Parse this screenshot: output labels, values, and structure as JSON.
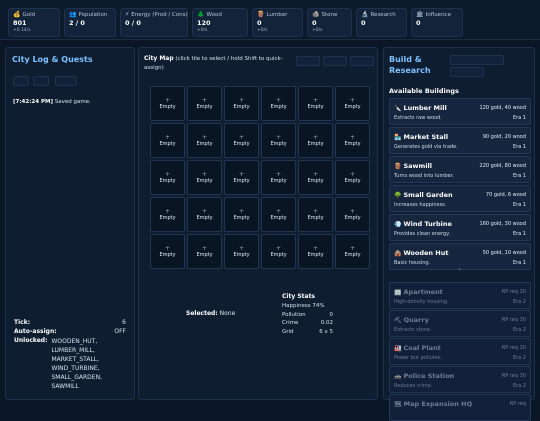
{
  "resources": [
    {
      "icon": "💰",
      "icon_name": "gold-icon",
      "label": "Gold",
      "value": "801",
      "rate": "+0.14/s"
    },
    {
      "icon": "👥",
      "icon_name": "population-icon",
      "label": "Population",
      "value": "2 / 0",
      "rate": ""
    },
    {
      "icon": "⚡",
      "icon_name": "energy-icon",
      "label": "Energy (Prod / Cons)",
      "value": "0 / 0",
      "rate": ""
    },
    {
      "icon": "🌲",
      "icon_name": "wood-icon",
      "label": "Wood",
      "value": "120",
      "rate": "+0/s"
    },
    {
      "icon": "🪵",
      "icon_name": "lumber-icon",
      "label": "Lumber",
      "value": "0",
      "rate": "+0/s"
    },
    {
      "icon": "🪨",
      "icon_name": "stone-icon",
      "label": "Stone",
      "value": "0",
      "rate": "+0/s"
    },
    {
      "icon": "🔬",
      "icon_name": "research-icon",
      "label": "Research",
      "value": "0",
      "rate": ""
    },
    {
      "icon": "🏛",
      "icon_name": "influence-icon",
      "label": "Influence",
      "value": "0",
      "rate": ""
    }
  ],
  "left": {
    "title": "City Log & Quests",
    "log_time": "[7:42:24 PM]",
    "log_text": "Saved game.",
    "tick_label": "Tick:",
    "tick_value": "6",
    "autoassign_label": "Auto-assign:",
    "autoassign_value": "OFF",
    "unlocked_label": "Unlocked:",
    "unlocked_value": "WOODEN_HUT, LUMBER_MILL, MARKET_STALL, WIND_TURBINE, SMALL_GARDEN, SAWMILL"
  },
  "center": {
    "map_title": "City Map",
    "map_hint": "(click tile to select / hold Shift to quick-assign)",
    "tile_plus": "+",
    "tile_label": "Empty",
    "selected_label": "Selected:",
    "selected_value": "None",
    "stats_title": "City Stats",
    "stats_happiness": "Happiness 74%",
    "stats_pollution_label": "Pollution",
    "stats_pollution_value": "0",
    "stats_crime_label": "Crime",
    "stats_crime_value": "0.02",
    "stats_grid_label": "Grid",
    "stats_grid_value": "6 x 5"
  },
  "right": {
    "title": "Build & Research",
    "available_title": "Available Buildings",
    "separator": "•",
    "buildings": [
      {
        "icon": "🔪",
        "icon_name": "lumber-mill-icon",
        "name": "Lumber Mill",
        "desc": "Extracts raw wood.",
        "cost": "120 gold, 40 wood",
        "era": "Era 1",
        "locked": false
      },
      {
        "icon": "🏪",
        "icon_name": "market-stall-icon",
        "name": "Market Stall",
        "desc": "Generates gold via trade.",
        "cost": "90 gold, 20 wood",
        "era": "Era 1",
        "locked": false
      },
      {
        "icon": "🪵",
        "icon_name": "sawmill-icon",
        "name": "Sawmill",
        "desc": "Turns wood into lumber.",
        "cost": "220 gold, 80 wood",
        "era": "Era 1",
        "locked": false
      },
      {
        "icon": "🌳",
        "icon_name": "small-garden-icon",
        "name": "Small Garden",
        "desc": "Increases happiness.",
        "cost": "70 gold, 6 wood",
        "era": "Era 1",
        "locked": false
      },
      {
        "icon": "💨",
        "icon_name": "wind-turbine-icon",
        "name": "Wind Turbine",
        "desc": "Provides clean energy.",
        "cost": "160 gold, 30 wood",
        "era": "Era 1",
        "locked": false
      },
      {
        "icon": "🛖",
        "icon_name": "wooden-hut-icon",
        "name": "Wooden Hut",
        "desc": "Basic housing.",
        "cost": "50 gold, 10 wood",
        "era": "Era 1",
        "locked": false
      },
      {
        "icon": "🏢",
        "icon_name": "apartment-icon",
        "name": "Apartment",
        "desc": "High-density housing.",
        "cost": "RP req 30",
        "era": "Era 2",
        "locked": true
      },
      {
        "icon": "⛏",
        "icon_name": "quarry-icon",
        "name": "Quarry",
        "desc": "Extracts stone.",
        "cost": "RP req 30",
        "era": "Era 2",
        "locked": true
      },
      {
        "icon": "🏭",
        "icon_name": "coal-plant-icon",
        "name": "Coal Plant",
        "desc": "Power but pollutes.",
        "cost": "RP req 30",
        "era": "Era 2",
        "locked": true
      },
      {
        "icon": "🚓",
        "icon_name": "police-station-icon",
        "name": "Police Station",
        "desc": "Reduces crime.",
        "cost": "RP req 30",
        "era": "Era 2",
        "locked": true
      },
      {
        "icon": "🗺",
        "icon_name": "map-expansion-icon",
        "name": "Map Expansion HQ",
        "desc": "",
        "cost": "RP req",
        "era": "",
        "locked": true
      }
    ]
  }
}
